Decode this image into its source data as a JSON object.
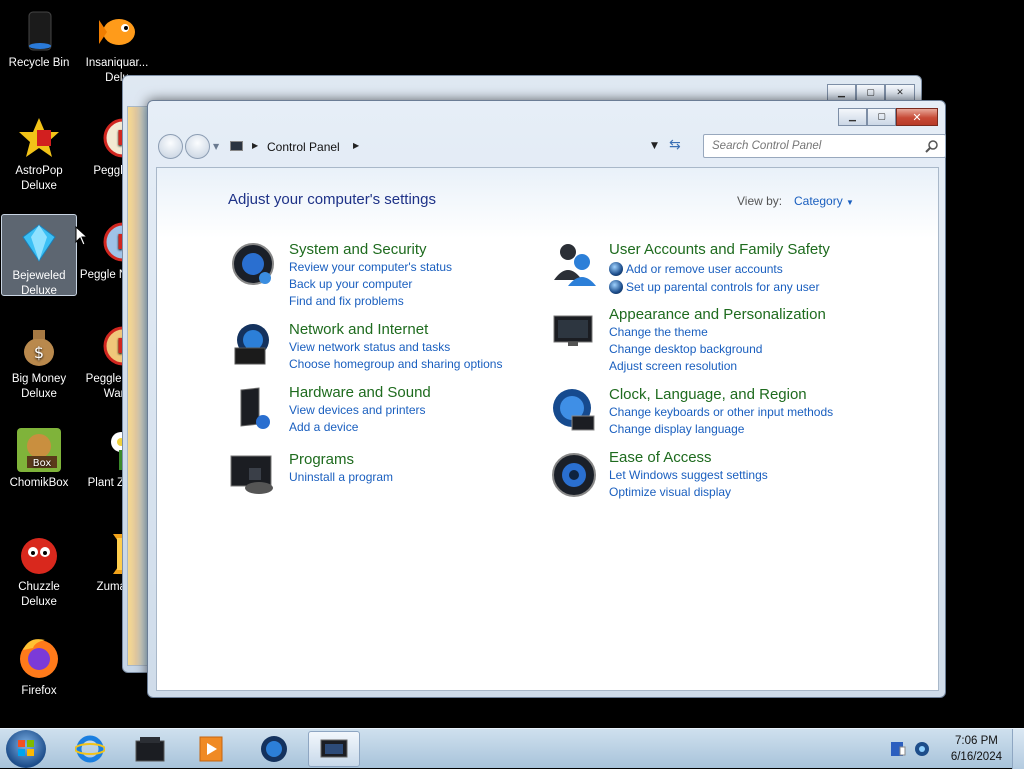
{
  "desktop": {
    "icons": [
      {
        "label": "Recycle Bin"
      },
      {
        "label": "Insaniquar... Delu"
      },
      {
        "label": "AstroPop Deluxe"
      },
      {
        "label": "Peggle D"
      },
      {
        "label": "Bejeweled Deluxe"
      },
      {
        "label": "Peggle N Delu"
      },
      {
        "label": "Big Money Deluxe"
      },
      {
        "label": "Peggle W of Warc"
      },
      {
        "label": "ChomikBox"
      },
      {
        "label": "Plant Zomb"
      },
      {
        "label": "Chuzzle Deluxe"
      },
      {
        "label": "Zuma D"
      },
      {
        "label": "Firefox"
      }
    ]
  },
  "window": {
    "breadcrumb": "Control Panel",
    "search_placeholder": "Search Control Panel",
    "heading": "Adjust your computer's settings",
    "view_by_label": "View by:",
    "view_by_value": "Category",
    "categories": [
      {
        "title": "System and Security",
        "icon": "system-security-icon",
        "links": [
          "Review your computer's status",
          "Back up your computer",
          "Find and fix problems"
        ]
      },
      {
        "title": "Network and Internet",
        "icon": "network-internet-icon",
        "links": [
          "View network status and tasks",
          "Choose homegroup and sharing options"
        ]
      },
      {
        "title": "Hardware and Sound",
        "icon": "hardware-sound-icon",
        "links": [
          "View devices and printers",
          "Add a device"
        ]
      },
      {
        "title": "Programs",
        "icon": "programs-icon",
        "links": [
          "Uninstall a program"
        ]
      },
      {
        "title": "User Accounts and Family Safety",
        "icon": "user-accounts-icon",
        "links": [
          "Add or remove user accounts",
          "Set up parental controls for any user"
        ]
      },
      {
        "title": "Appearance and Personalization",
        "icon": "appearance-icon",
        "links": [
          "Change the theme",
          "Change desktop background",
          "Adjust screen resolution"
        ]
      },
      {
        "title": "Clock, Language, and Region",
        "icon": "clock-language-icon",
        "links": [
          "Change keyboards or other input methods",
          "Change display language"
        ]
      },
      {
        "title": "Ease of Access",
        "icon": "ease-of-access-icon",
        "links": [
          "Let Windows suggest settings",
          "Optimize visual display"
        ]
      }
    ]
  },
  "taskbar": {
    "time": "7:06 PM",
    "date": "6/16/2024"
  },
  "colors": {
    "link": "#1a5fbf",
    "category_title": "#1e6b1e",
    "heading": "#1e3287"
  }
}
